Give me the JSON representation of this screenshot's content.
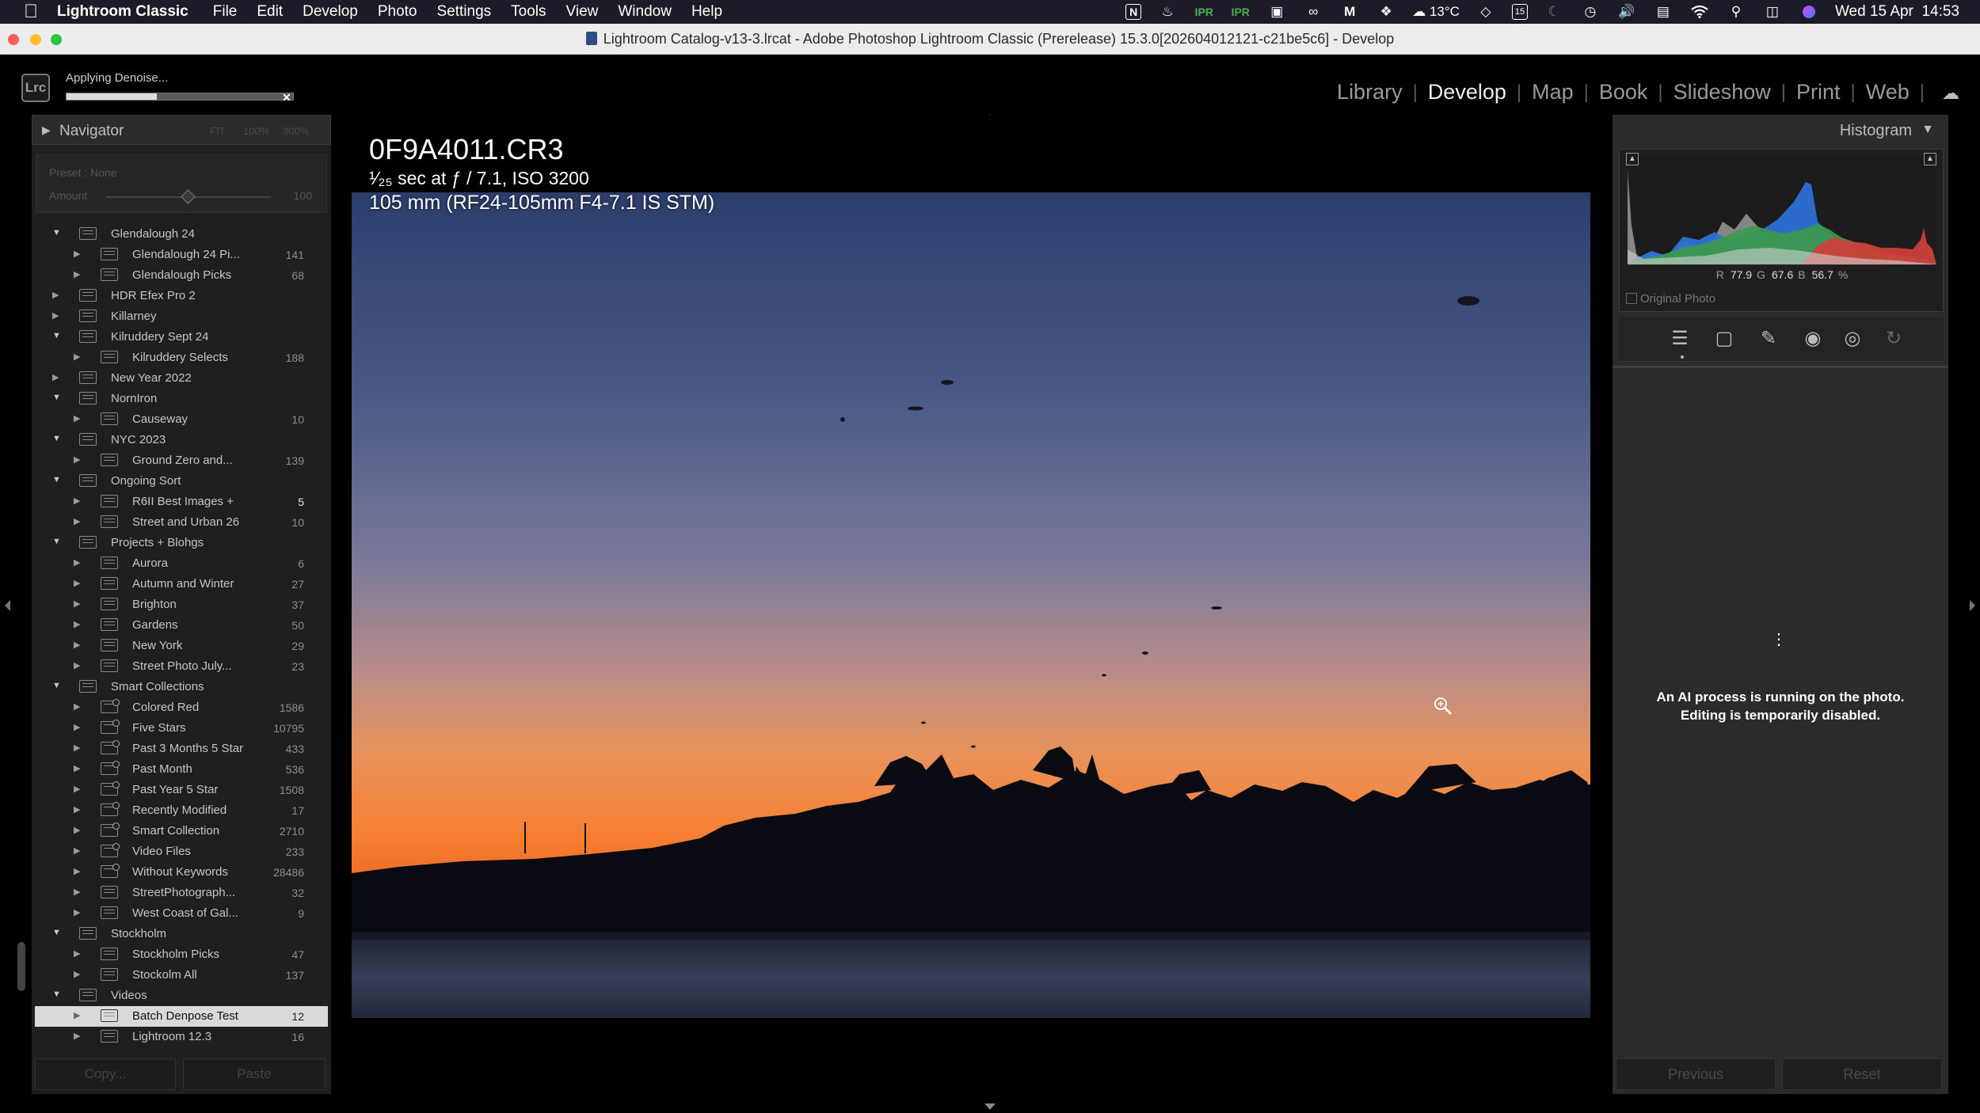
{
  "menubar": {
    "app_name": "Lightroom Classic",
    "items": [
      "File",
      "Edit",
      "Develop",
      "Photo",
      "Settings",
      "Tools",
      "View",
      "Window",
      "Help"
    ],
    "status": {
      "temperature": "13°C",
      "clock": "Wed 15 Apr  14:53"
    }
  },
  "window": {
    "title": "Lightroom Catalog-v13-3.lrcat - Adobe Photoshop Lightroom Classic (Prerelease) 15.3.0[202604012121-c21be5c6] - Develop"
  },
  "app": {
    "logo": "Lrc"
  },
  "progress": {
    "label": "Applying Denoise...",
    "fraction": 0.4
  },
  "modules": [
    "Library",
    "Develop",
    "Map",
    "Book",
    "Slideshow",
    "Print",
    "Web"
  ],
  "active_module": "Develop",
  "navigator": {
    "title": "Navigator",
    "zoom_fit": "FIT",
    "zoom_1": "100%",
    "zoom_2": "300%"
  },
  "preset": {
    "label": "Preset : None",
    "amount_label": "Amount",
    "amount_value": "100",
    "amount_fraction": 0.52
  },
  "collections": [
    {
      "name": "Glendalough 24",
      "level": 0,
      "open": true,
      "type": "set",
      "count": ""
    },
    {
      "name": "Glendalough 24 Pi...",
      "level": 1,
      "type": "collection",
      "count": "141"
    },
    {
      "name": "Glendalough Picks",
      "level": 1,
      "type": "collection",
      "count": "68"
    },
    {
      "name": "HDR Efex Pro 2",
      "level": 0,
      "open": false,
      "type": "set",
      "count": ""
    },
    {
      "name": "Killarney",
      "level": 0,
      "open": false,
      "type": "set",
      "count": ""
    },
    {
      "name": "Kilruddery Sept 24",
      "level": 0,
      "open": true,
      "type": "set",
      "count": ""
    },
    {
      "name": "Kilruddery Selects",
      "level": 1,
      "type": "collection",
      "count": "188"
    },
    {
      "name": "New Year 2022",
      "level": 0,
      "open": false,
      "type": "set",
      "count": ""
    },
    {
      "name": "NornIron",
      "level": 0,
      "open": true,
      "type": "set",
      "count": ""
    },
    {
      "name": "Causeway",
      "level": 1,
      "type": "collection",
      "count": "10"
    },
    {
      "name": "NYC 2023",
      "level": 0,
      "open": true,
      "type": "set",
      "count": ""
    },
    {
      "name": "Ground Zero and...",
      "level": 1,
      "type": "collection",
      "count": "139"
    },
    {
      "name": "Ongoing Sort",
      "level": 0,
      "open": true,
      "type": "set",
      "count": ""
    },
    {
      "name": "R6II Best Images  +",
      "level": 1,
      "type": "collection",
      "count": "5",
      "bright": true
    },
    {
      "name": "Street and Urban 26",
      "level": 1,
      "type": "collection",
      "count": "10"
    },
    {
      "name": "Projects + Blohgs",
      "level": 0,
      "open": true,
      "type": "set",
      "count": ""
    },
    {
      "name": "Aurora",
      "level": 1,
      "type": "collection",
      "count": "6"
    },
    {
      "name": "Autumn and Winter",
      "level": 1,
      "type": "collection",
      "count": "27"
    },
    {
      "name": "Brighton",
      "level": 1,
      "type": "collection",
      "count": "37"
    },
    {
      "name": "Gardens",
      "level": 1,
      "type": "collection",
      "count": "50"
    },
    {
      "name": "New York",
      "level": 1,
      "type": "collection",
      "count": "29"
    },
    {
      "name": "Street Photo July...",
      "level": 1,
      "type": "collection",
      "count": "23"
    },
    {
      "name": "Smart Collections",
      "level": 0,
      "open": true,
      "type": "set",
      "count": ""
    },
    {
      "name": "Colored Red",
      "level": 1,
      "type": "smart",
      "count": "1586"
    },
    {
      "name": "Five Stars",
      "level": 1,
      "type": "smart",
      "count": "10795"
    },
    {
      "name": "Past 3 Months 5 Star",
      "level": 1,
      "type": "smart",
      "count": "433"
    },
    {
      "name": "Past Month",
      "level": 1,
      "type": "smart",
      "count": "536"
    },
    {
      "name": "Past Year 5 Star",
      "level": 1,
      "type": "smart",
      "count": "1508"
    },
    {
      "name": "Recently Modified",
      "level": 1,
      "type": "smart",
      "count": "17"
    },
    {
      "name": "Smart Collection",
      "level": 1,
      "type": "smart",
      "count": "2710"
    },
    {
      "name": "Video Files",
      "level": 1,
      "type": "smart",
      "count": "233"
    },
    {
      "name": "Without Keywords",
      "level": 1,
      "type": "smart",
      "count": "28486"
    },
    {
      "name": "StreetPhotograph...",
      "level": 1,
      "type": "collection",
      "count": "32"
    },
    {
      "name": "West Coast of Gal...",
      "level": 1,
      "type": "collection",
      "count": "9"
    },
    {
      "name": "Stockholm",
      "level": 0,
      "open": true,
      "type": "set",
      "count": ""
    },
    {
      "name": "Stockholm Picks",
      "level": 1,
      "type": "collection",
      "count": "47"
    },
    {
      "name": "Stockolm All",
      "level": 1,
      "type": "collection",
      "count": "137"
    },
    {
      "name": "Videos",
      "level": 0,
      "open": true,
      "type": "set",
      "count": ""
    },
    {
      "name": "Batch Denpose Test",
      "level": 1,
      "type": "collection",
      "count": "12",
      "selected": true
    },
    {
      "name": "Lightroom 12.3",
      "level": 1,
      "type": "collection",
      "count": "16"
    }
  ],
  "left_buttons": {
    "copy": "Copy...",
    "paste": "Paste"
  },
  "photo_info": {
    "filename": "0F9A4011.CR3",
    "exposure": "¹⁄₂₅ sec at ƒ / 7.1, ISO 3200",
    "lens": "105 mm (RF24-105mm F4-7.1 IS STM)"
  },
  "histogram": {
    "title": "Histogram",
    "r_label": "R",
    "r_value": "77.9",
    "g_label": "G",
    "g_value": "67.6",
    "b_label": "B",
    "b_value": "56.7",
    "unit": "%",
    "original_photo": "Original Photo"
  },
  "tools": [
    "adjust-icon",
    "crop-icon",
    "healing-icon",
    "redeye-icon",
    "masking-icon",
    "reset-icon"
  ],
  "ai_message": {
    "line1": "An AI process is running on the photo.",
    "line2": "Editing is temporarily disabled."
  },
  "right_buttons": {
    "previous": "Previous",
    "reset": "Reset"
  }
}
